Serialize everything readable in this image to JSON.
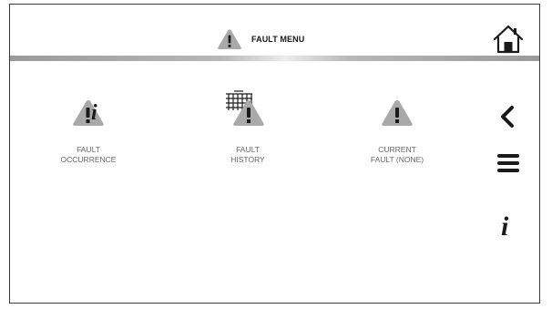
{
  "header": {
    "title": "FAULT MENU",
    "title_icon": "warning-triangle-icon",
    "home_icon": "home-icon"
  },
  "tiles": [
    {
      "line1": "FAULT",
      "line2": "OCCURRENCE",
      "icon": "warning-info-icon"
    },
    {
      "line1": "FAULT",
      "line2": "HISTORY",
      "icon": "warning-history-grid-icon"
    },
    {
      "line1": "CURRENT",
      "line2": "FAULT (NONE)",
      "icon": "warning-triangle-icon"
    }
  ],
  "side_nav": {
    "back_icon": "chevron-left-icon",
    "menu_icon": "hamburger-menu-icon",
    "info_icon": "info-icon"
  },
  "colors": {
    "triangle_gray": "#a9a9a9",
    "icon_dark": "#1a1a1a",
    "label_gray": "#666666",
    "frame_border": "#3a3a3a"
  }
}
